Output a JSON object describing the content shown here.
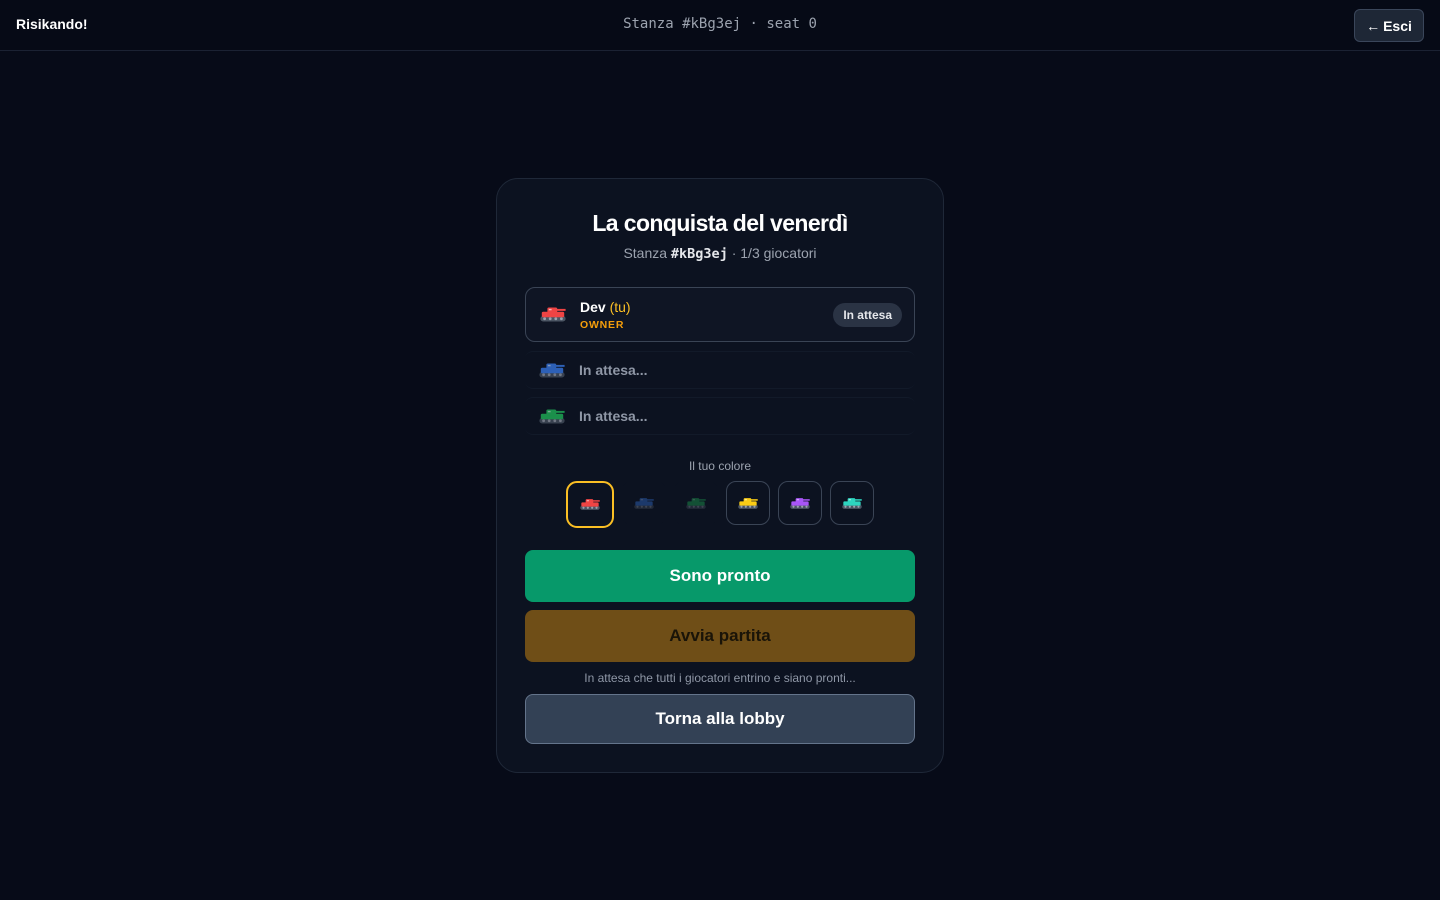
{
  "header": {
    "brand": "Risikando!",
    "room_info": "Stanza #kBg3ej · seat 0",
    "exit_arrow": "←",
    "exit_label": "Esci"
  },
  "room": {
    "title": "La conquista del venerdì",
    "subtitle_prefix": "Stanza",
    "code": "#kBg3ej",
    "subtitle_suffix": "· 1/3 giocatori"
  },
  "seats": [
    {
      "name": "Dev",
      "you_tag": "(tu)",
      "role": "OWNER",
      "status": "In attesa",
      "color": "#ef4444",
      "icon": "tank-icon"
    },
    {
      "label": "In attesa...",
      "color": "#3b82f6",
      "icon": "tank-icon"
    },
    {
      "label": "In attesa...",
      "color": "#22c55e",
      "icon": "tank-icon"
    }
  ],
  "color_picker": {
    "label": "Il tuo colore",
    "options": [
      {
        "color": "#ef4444",
        "state": "selected"
      },
      {
        "color": "#3b82f6",
        "state": "taken"
      },
      {
        "color": "#22c55e",
        "state": "taken"
      },
      {
        "color": "#facc15",
        "state": "available"
      },
      {
        "color": "#a855f7",
        "state": "available"
      },
      {
        "color": "#2dd4bf",
        "state": "available"
      }
    ]
  },
  "actions": {
    "ready_label": "Sono pronto",
    "start_label": "Avvia partita",
    "hint": "In attesa che tutti i giocatori entrino e siano pronti...",
    "lobby_label": "Torna alla lobby"
  },
  "colors": {
    "accent": "#fbbf24",
    "ready": "#07996a",
    "start_disabled": "#6f4e17"
  }
}
